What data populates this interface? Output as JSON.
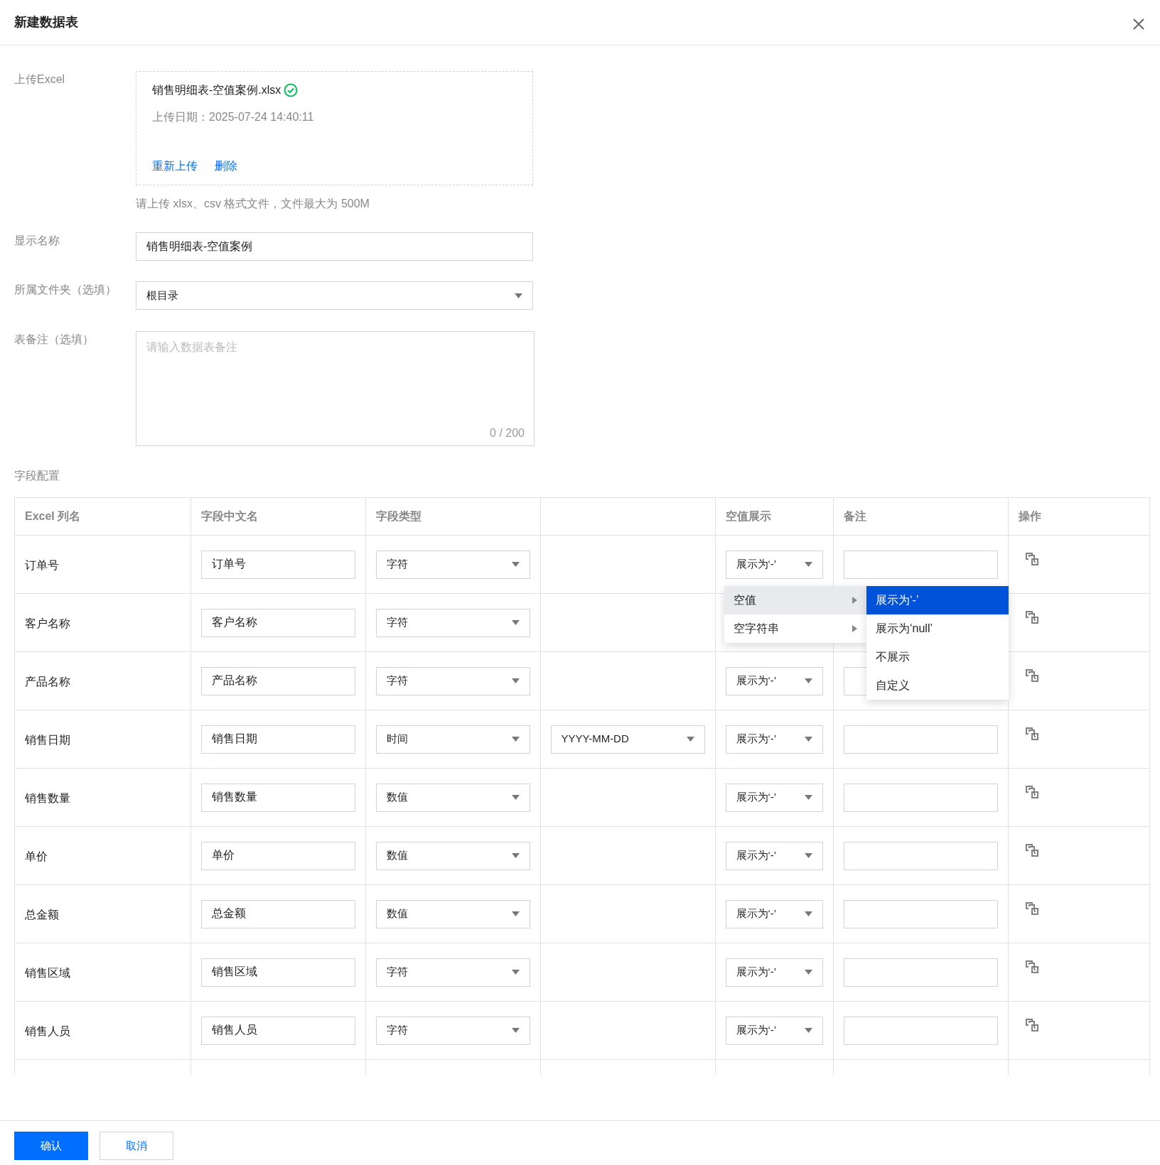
{
  "dialog": {
    "title": "新建数据表"
  },
  "upload": {
    "label": "上传Excel",
    "file_name": "销售明细表-空值案例.xlsx",
    "upload_date": "上传日期：2025-07-24 14:40:11",
    "actions": [
      "重新上传",
      "删除"
    ],
    "hint": "请上传 xlsx、csv 格式文件，文件最大为 500M"
  },
  "display_name": {
    "label": "显示名称",
    "value": "销售明细表-空值案例"
  },
  "folder": {
    "label": "所属文件夹（选填）",
    "value": "根目录"
  },
  "remark": {
    "label": "表备注（选填）",
    "placeholder": "请输入数据表备注",
    "counter": "0 / 200"
  },
  "fields": {
    "label": "字段配置",
    "columns": [
      {
        "kind": "text",
        "label": "Excel 列名"
      },
      {
        "kind": "text",
        "label": "字段中文名"
      },
      {
        "kind": "text",
        "label": "字段类型"
      },
      {
        "kind": "blank"
      },
      {
        "kind": "text",
        "label": "空值展示"
      },
      {
        "kind": "text",
        "label": "备注"
      },
      {
        "kind": "text",
        "label": "操作"
      }
    ],
    "rows": [
      {
        "excel": "订单号",
        "name": "订单号",
        "type": "字符",
        "null_display": "展示为‘-’"
      },
      {
        "excel": "客户名称",
        "name": "客户名称",
        "type": "字符"
      },
      {
        "excel": "产品名称",
        "name": "产品名称",
        "type": "字符",
        "null_display": "展示为‘-’"
      },
      {
        "excel": "销售日期",
        "name": "销售日期",
        "type": "时间",
        "format": "YYYY-MM-DD",
        "null_display": "展示为‘-’"
      },
      {
        "excel": "销售数量",
        "name": "销售数量",
        "type": "数值",
        "null_display": "展示为‘-’"
      },
      {
        "excel": "单价",
        "name": "单价",
        "type": "数值",
        "null_display": "展示为‘-’"
      },
      {
        "excel": "总金额",
        "name": "总金额",
        "type": "数值",
        "null_display": "展示为‘-’"
      },
      {
        "excel": "销售区域",
        "name": "销售区域",
        "type": "字符",
        "null_display": "展示为‘-’"
      },
      {
        "excel": "销售人员",
        "name": "销售人员",
        "type": "字符",
        "null_display": "展示为‘-’"
      }
    ],
    "cascader": {
      "options": [
        {
          "label": "空值",
          "selected": true
        },
        {
          "label": "空字符串",
          "selected": false
        }
      ],
      "suboptions": [
        {
          "label": "展示为‘-’",
          "selected": true
        },
        {
          "label": "展示为‘null’",
          "selected": false
        },
        {
          "label": "不展示",
          "selected": false
        },
        {
          "label": "自定义",
          "selected": false
        }
      ]
    }
  },
  "footer": {
    "buttons": [
      {
        "kind": "primary",
        "label": "确认"
      },
      {
        "kind": "secondary",
        "label": "取消"
      }
    ]
  }
}
